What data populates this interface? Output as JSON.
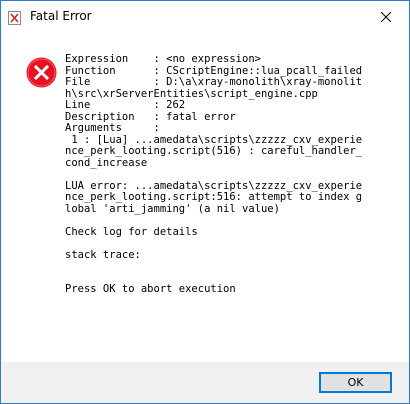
{
  "window": {
    "title": "Fatal Error",
    "app_icon": "xray-app-icon",
    "close_icon": "close-icon"
  },
  "message": {
    "icon": "error-icon",
    "text": "Expression    : <no expression>\nFunction      : CScriptEngine::lua_pcall_failed\nFile          : D:\\a\\xray-monolith\\xray-monolith\\src\\xrServerEntities\\script_engine.cpp\nLine          : 262\nDescription   : fatal error\nArguments     :\n 1 : [Lua] ...amedata\\scripts\\zzzzz_cxv_experience_perk_looting.script(516) : careful_handler_cond_increase\n\nLUA error: ...amedata\\scripts\\zzzzz_cxv_experience_perk_looting.script:516: attempt to index global 'arti_jamming' (a nil value)\n\nCheck log for details\n\nstack trace:\n\n\nPress OK to abort execution"
  },
  "buttons": {
    "ok_label": "OK"
  },
  "colors": {
    "error_red": "#e81123",
    "accent": "#0078d7",
    "footer_bg": "#f0f0f0"
  }
}
